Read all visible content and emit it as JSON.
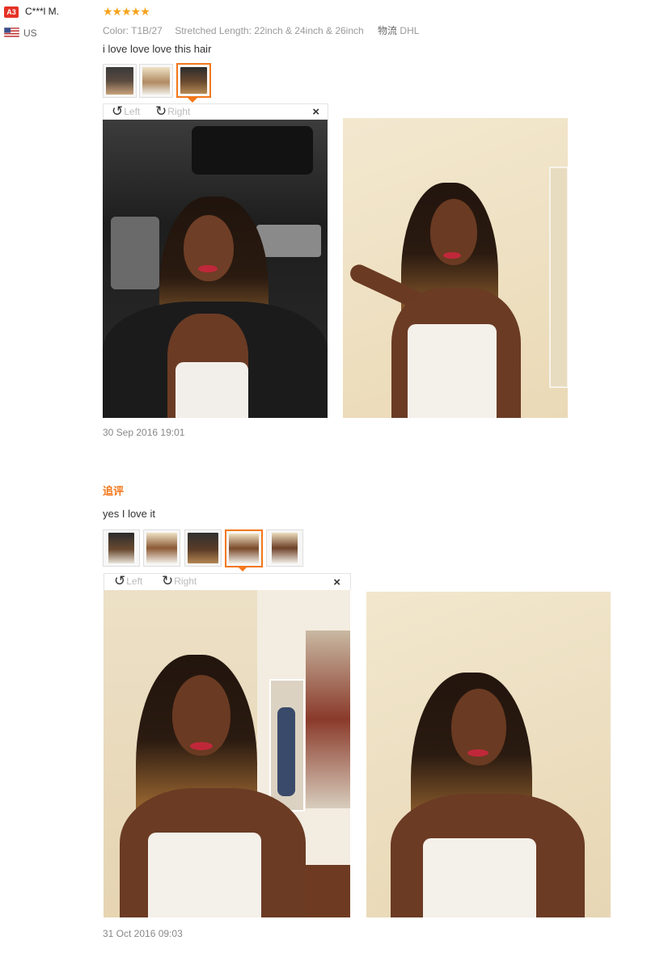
{
  "review": {
    "avatar_badge": "A3",
    "username": "C***l M.",
    "country": "US",
    "rating_stars": "★★★★★",
    "rating": 5,
    "color_label": "Color:",
    "color_value": "T1B/27",
    "length_label": "Stretched Length:",
    "length_value": "22inch & 24inch & 26inch",
    "shipping_label": "物流",
    "shipping_value": "DHL",
    "text": "i love love love this hair",
    "date": "30 Sep 2016 19:01",
    "viewer": {
      "rotate_left_label": "Left",
      "rotate_right_label": "Right",
      "close_label": "×"
    }
  },
  "followup": {
    "heading": "追评",
    "text": "yes I love it",
    "date": "31 Oct 2016 09:03",
    "viewer": {
      "rotate_left_label": "Left",
      "rotate_right_label": "Right",
      "close_label": "×"
    }
  },
  "colors": {
    "accent": "#f4771a",
    "badge": "#e43225",
    "star": "#f7a31c",
    "wall": "#f0e4c8",
    "car_interior": "#2a2a2a",
    "skin": "#6b3b24",
    "hair_dark": "#2a1a12",
    "hair_light": "#b7803f",
    "top": "#f4f0ea"
  },
  "icons": {
    "rotate_left": "rotate-left-icon",
    "rotate_right": "rotate-right-icon",
    "close": "close-icon",
    "flag": "us-flag-icon",
    "star": "star-icon"
  }
}
